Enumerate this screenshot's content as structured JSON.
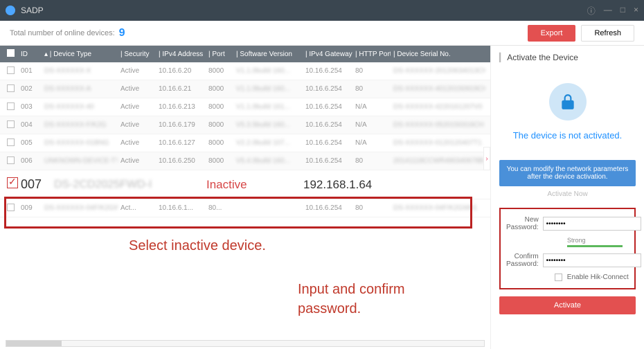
{
  "titlebar": {
    "title": "SADP"
  },
  "subbar": {
    "label": "Total number of online devices:",
    "count": "9",
    "export": "Export",
    "refresh": "Refresh"
  },
  "columns": {
    "cb": "",
    "id": "ID",
    "type": "Device Type",
    "sec": "Security",
    "ip": "IPv4 Address",
    "port": "Port",
    "ver": "Software Version",
    "gw": "IPv4 Gateway",
    "http": "HTTP Port",
    "sn": "Device Serial No."
  },
  "rows": [
    {
      "id": "001",
      "type": "DS-XXXXXX-X",
      "sec": "Active",
      "ip": "10.16.6.20",
      "port": "8000",
      "ver": "V1.1.0build 160...",
      "gw": "10.16.6.254",
      "http": "80",
      "sn": "DS-XXXXXX-20120634013CH"
    },
    {
      "id": "002",
      "type": "DS-XXXXXX-A",
      "sec": "Active",
      "ip": "10.16.6.21",
      "port": "8000",
      "ver": "V1.1.0build 160...",
      "gw": "10.16.6.254",
      "http": "80",
      "sn": "DS-XXXXXX-40120150919CH"
    },
    {
      "id": "003",
      "type": "DS-XXXXXX-40",
      "sec": "Active",
      "ip": "10.16.6.213",
      "port": "8000",
      "ver": "V1.1.0build 161...",
      "gw": "10.16.6.254",
      "http": "N/A",
      "sn": "DS-XXXXXX-4220161207V0"
    },
    {
      "id": "004",
      "type": "DS-XXXXXX-F/K2G",
      "sec": "Active",
      "ip": "10.16.6.179",
      "port": "8000",
      "ver": "V5.3.5build 160...",
      "gw": "10.16.6.254",
      "http": "N/A",
      "sn": "DS-XXXXXX-0520150316CH"
    },
    {
      "id": "005",
      "type": "DS-XXXXXX-01BNG",
      "sec": "Active",
      "ip": "10.16.6.127",
      "port": "8000",
      "ver": "V2.2.0build 107...",
      "gw": "10.16.6.254",
      "http": "N/A",
      "sn": "DS-XXXXXX-0120120407T1"
    },
    {
      "id": "006",
      "type": "UNKNOWN-DEVICE-TYPE",
      "sec": "Active",
      "ip": "10.16.6.250",
      "port": "8000",
      "ver": "V5.4.0build 160...",
      "gw": "10.16.6.254",
      "http": "80",
      "sn": "20141118CCWR490340678B"
    }
  ],
  "selected": {
    "id": "007",
    "type": "DS-2CD2025FWD-I",
    "status": "Inactive",
    "ip": "192.168.1.64"
  },
  "after_rows": [
    {
      "id": "009",
      "type": "DS-XXXXXX-04F/K2GW",
      "sec": "Act...",
      "ip": "10.16.6.1...",
      "port": "80...",
      "ver": "",
      "gw": "10.16.6.254",
      "http": "80",
      "sn": "DS-XXXXXX-04F/K2GW01"
    }
  ],
  "annotations": {
    "select": "Select inactive device.",
    "pwd": "Input and confirm\npassword."
  },
  "panel": {
    "title": "Activate the Device",
    "not_activated": "The device is not activated.",
    "tip": "You can modify the network parameters after the device activation.",
    "activate_now": "Activate Now",
    "new_pwd": "New Password:",
    "strength": "Strong",
    "confirm_pwd": "Confirm Password:",
    "hik": "Enable Hik-Connect",
    "activate": "Activate",
    "pwd_value": "••••••••"
  }
}
